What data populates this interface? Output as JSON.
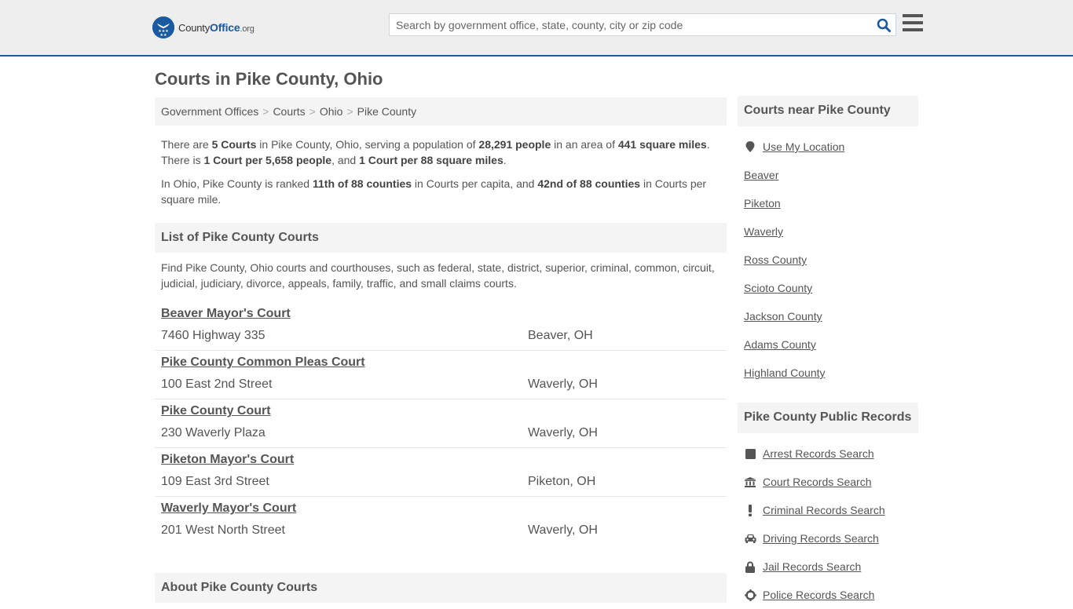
{
  "header": {
    "logo": {
      "name": "County",
      "name_bold": "Office",
      "tld": ".org",
      "badge_glyph": "★★★"
    },
    "search": {
      "placeholder": "Search by government office, state, county, city or zip code",
      "value": ""
    },
    "colors": {
      "brand": "#1a5aa0",
      "header_bg": "#eeeeee"
    }
  },
  "page": {
    "title": "Courts in Pike County, Ohio"
  },
  "breadcrumb": [
    "Government Offices",
    "Courts",
    "Ohio",
    "Pike County"
  ],
  "summary": {
    "p1": {
      "t1": "There are ",
      "b1": "5 Courts",
      "t2": " in Pike County, Ohio, serving a population of ",
      "b2": "28,291 people",
      "t3": " in an area of ",
      "b3": "441 square miles",
      "t4": ". There is ",
      "b4": "1 Court per 5,658 people",
      "t5": ", and ",
      "b5": "1 Court per 88 square miles",
      "t6": "."
    },
    "p2": {
      "t1": "In Ohio, Pike County is ranked ",
      "b1": "11th of 88 counties",
      "t2": " in Courts per capita, and ",
      "b2": "42nd of 88 counties",
      "t3": " in Courts per square mile."
    }
  },
  "list": {
    "heading": "List of Pike County Courts",
    "intro": "Find Pike County, Ohio courts and courthouses, such as federal, state, district, superior, criminal, common, circuit, judicial, judiciary, divorce, appeals, family, traffic, and small claims courts.",
    "courts": [
      {
        "name": "Beaver Mayor's Court",
        "address": "7460 Highway 335",
        "city": "Beaver, OH"
      },
      {
        "name": "Pike County Common Pleas Court",
        "address": "100 East 2nd Street",
        "city": "Waverly, OH"
      },
      {
        "name": "Pike County Court",
        "address": "230 Waverly Plaza",
        "city": "Waverly, OH"
      },
      {
        "name": "Piketon Mayor's Court",
        "address": "109 East 3rd Street",
        "city": "Piketon, OH"
      },
      {
        "name": "Waverly Mayor's Court",
        "address": "201 West North Street",
        "city": "Waverly, OH"
      }
    ]
  },
  "about": {
    "heading": "About Pike County Courts"
  },
  "sidebar": {
    "near": {
      "heading": "Courts near Pike County",
      "use_location": "Use My Location",
      "links": [
        "Beaver",
        "Piketon",
        "Waverly",
        "Ross County",
        "Scioto County",
        "Jackson County",
        "Adams County",
        "Highland County"
      ]
    },
    "records": {
      "heading": "Pike County Public Records",
      "links": [
        {
          "label": "Arrest Records Search",
          "icon": "square-icon"
        },
        {
          "label": "Court Records Search",
          "icon": "courthouse-icon"
        },
        {
          "label": "Criminal Records Search",
          "icon": "exclamation-icon"
        },
        {
          "label": "Driving Records Search",
          "icon": "car-icon"
        },
        {
          "label": "Jail Records Search",
          "icon": "lock-icon"
        },
        {
          "label": "Police Records Search",
          "icon": "crosshair-icon"
        }
      ]
    }
  }
}
